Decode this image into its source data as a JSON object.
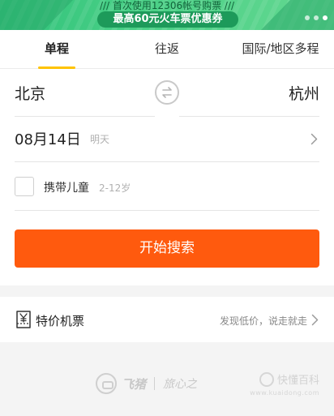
{
  "banner": {
    "line1": "/// 首次使用12306帐号购票 ///",
    "promo": "最高60元火车票优惠券"
  },
  "tabs": [
    {
      "label": "单程",
      "active": true
    },
    {
      "label": "往返",
      "active": false
    },
    {
      "label": "国际/地区多程",
      "active": false
    }
  ],
  "route": {
    "from": "北京",
    "to": "杭州"
  },
  "date": {
    "value": "08月14日",
    "hint": "明天"
  },
  "child": {
    "label": "携带儿童",
    "hint": "2-12岁",
    "checked": false
  },
  "search": {
    "label": "开始搜索"
  },
  "special": {
    "label": "特价机票",
    "hint": "发现低价，说走就走"
  },
  "footer": {
    "brand1": "飞猪",
    "brand2": "旅心之",
    "watermark": "快懂百科",
    "watermark_url": "www.kuaidong.com"
  },
  "colors": {
    "accent": "#ffc300",
    "button": "#ff5a0e",
    "banner": "#49cf86"
  }
}
